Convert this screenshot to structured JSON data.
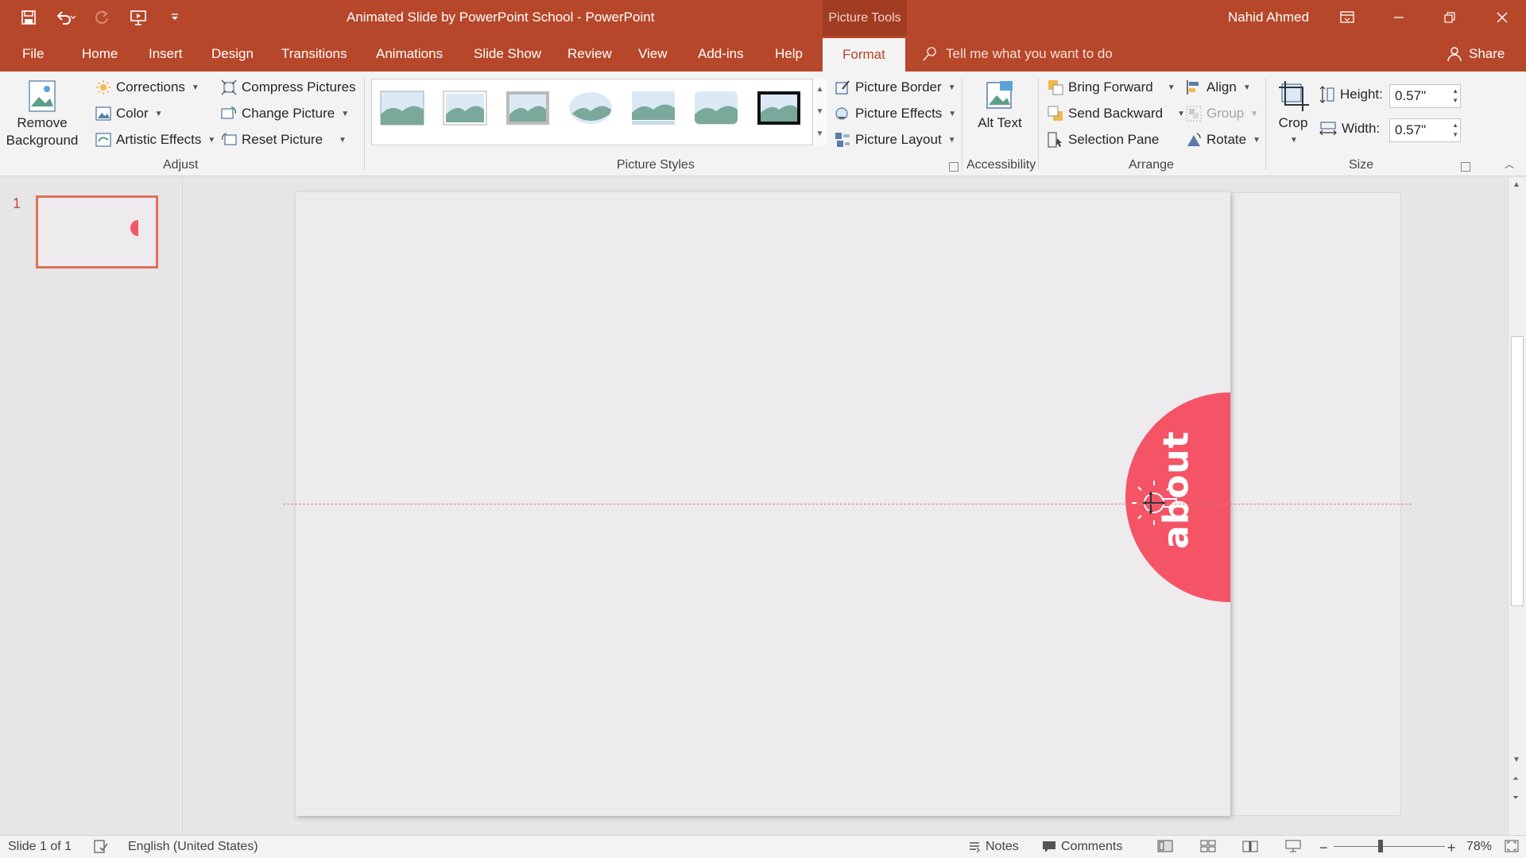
{
  "window": {
    "title": "Animated Slide by PowerPoint School  -  PowerPoint",
    "context_group": "Picture Tools",
    "user": "Nahid Ahmed"
  },
  "tabs": [
    "File",
    "Home",
    "Insert",
    "Design",
    "Transitions",
    "Animations",
    "Slide Show",
    "Review",
    "View",
    "Add-ins",
    "Help",
    "Format"
  ],
  "active_tab": "Format",
  "tell_me": "Tell me what you want to do",
  "share": "Share",
  "ribbon": {
    "adjust": {
      "remove_background": "Remove Background",
      "corrections": "Corrections",
      "color": "Color",
      "artistic_effects": "Artistic Effects",
      "compress": "Compress Pictures",
      "change_picture": "Change Picture",
      "reset_picture": "Reset Picture",
      "label": "Adjust"
    },
    "styles": {
      "label": "Picture Styles",
      "picture_border": "Picture Border",
      "picture_effects": "Picture Effects",
      "picture_layout": "Picture Layout"
    },
    "accessibility": {
      "alt_text": "Alt Text",
      "label": "Accessibility"
    },
    "arrange": {
      "bring_forward": "Bring Forward",
      "send_backward": "Send Backward",
      "selection_pane": "Selection Pane",
      "align": "Align",
      "group": "Group",
      "rotate": "Rotate",
      "label": "Arrange"
    },
    "size": {
      "crop": "Crop",
      "height_label": "Height:",
      "height_value": "0.57\"",
      "width_label": "Width:",
      "width_value": "0.57\"",
      "label": "Size"
    }
  },
  "thumbs": {
    "slide_number": "1"
  },
  "slide": {
    "shape_text": "about",
    "shape_color": "#f45466"
  },
  "status": {
    "slide_info": "Slide 1 of 1",
    "language": "English (United States)",
    "notes": "Notes",
    "comments": "Comments",
    "zoom": "78%"
  },
  "colors": {
    "accent": "#b7472a",
    "shape": "#f45466"
  }
}
